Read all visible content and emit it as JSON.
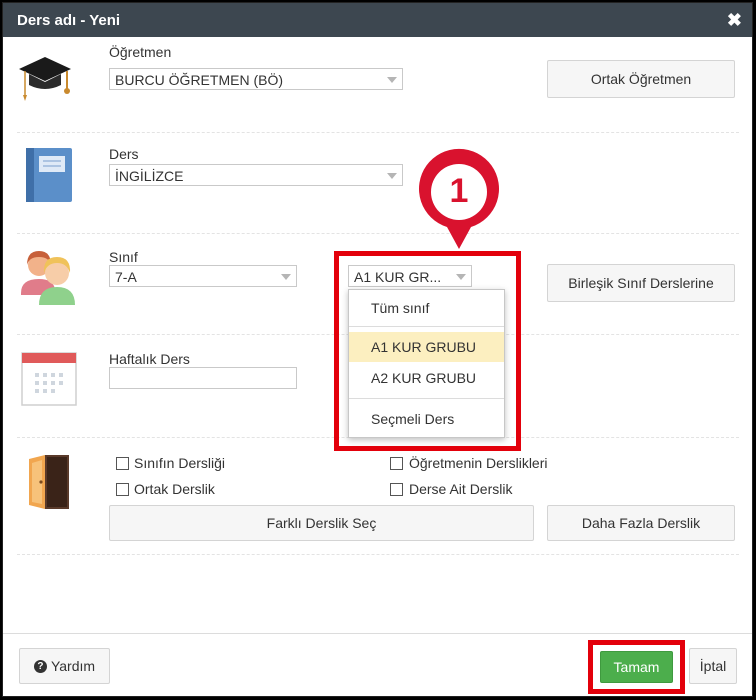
{
  "dialog": {
    "title": "Ders adı - Yeni"
  },
  "teacher": {
    "label": "Öğretmen",
    "value": "BURCU ÖĞRETMEN (BÖ)",
    "common_button": "Ortak Öğretmen"
  },
  "course": {
    "label": "Ders",
    "value": "İNGİLİZCE"
  },
  "class": {
    "label": "Sınıf",
    "value": "7-A",
    "group_value": "A1 KUR GR...",
    "merged_button": "Birleşik Sınıf Derslerine"
  },
  "group_menu": {
    "options": [
      "Tüm sınıf",
      "A1 KUR GRUBU",
      "A2 KUR GRUBU",
      "Seçmeli Ders"
    ],
    "highlighted": "A1 KUR GRUBU"
  },
  "weekly": {
    "label": "Haftalık Ders",
    "value": ""
  },
  "rooms": {
    "checkboxes": [
      "Sınıfın Dersliği",
      "Öğretmenin Derslikleri",
      "Ortak Derslik",
      "Derse Ait Derslik"
    ],
    "choose_button": "Farklı Derslik Seç",
    "more_button": "Daha Fazla Derslik"
  },
  "callout": {
    "number": "1"
  },
  "footer": {
    "help": "Yardım",
    "ok": "Tamam",
    "cancel": "İptal"
  },
  "colors": {
    "titlebar": "#3d4750",
    "highlight_red": "#e3000b",
    "callout_red": "#d9122e",
    "ok_green": "#4cae4c",
    "menu_highlight": "#fcefc0"
  }
}
